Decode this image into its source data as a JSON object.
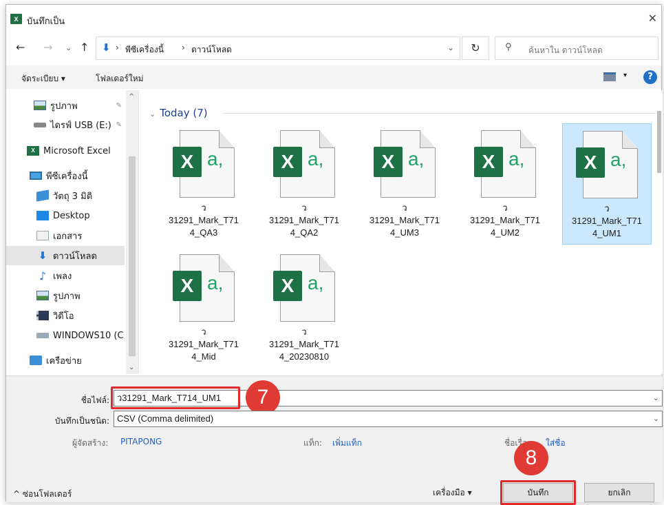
{
  "window": {
    "title": "บันทึกเป็น",
    "app_icon": "X"
  },
  "address": {
    "segment_1": "พีซีเครื่องนี้",
    "segment_2": "ดาวน์โหลด",
    "search_placeholder": "ค้นหาใน ดาวน์โหลด"
  },
  "toolbar": {
    "organize": "จัดระเบียบ ▾",
    "new_folder": "โฟลเดอร์ใหม่"
  },
  "sidebar": {
    "items": [
      {
        "label": "รูปภาพ",
        "icon": "pictures-icon",
        "pinned": true
      },
      {
        "label": "ไดรฟ์ USB (E:)",
        "icon": "usb-drive-icon",
        "pinned": true
      },
      {
        "label": "Microsoft Excel",
        "icon": "excel-icon"
      },
      {
        "label": "พีซีเครื่องนี้",
        "icon": "this-pc-icon"
      },
      {
        "label": "วัตถุ 3 มิติ",
        "icon": "3d-objects-icon"
      },
      {
        "label": "Desktop",
        "icon": "desktop-icon"
      },
      {
        "label": "เอกสาร",
        "icon": "documents-icon"
      },
      {
        "label": "ดาวน์โหลด",
        "icon": "downloads-icon",
        "selected": true
      },
      {
        "label": "เพลง",
        "icon": "music-icon"
      },
      {
        "label": "รูปภาพ",
        "icon": "pictures-icon"
      },
      {
        "label": "วิดีโอ",
        "icon": "videos-icon"
      },
      {
        "label": "WINDOWS10 (C",
        "icon": "drive-icon"
      },
      {
        "label": "เครือข่าย",
        "icon": "network-icon"
      }
    ]
  },
  "content": {
    "group_label": "Today (7)",
    "files": [
      {
        "name": "ว\n31291_Mark_T71\n4_QA3"
      },
      {
        "name": "ว\n31291_Mark_T71\n4_QA2"
      },
      {
        "name": "ว\n31291_Mark_T71\n4_UM3"
      },
      {
        "name": "ว\n31291_Mark_T71\n4_UM2"
      },
      {
        "name": "ว\n31291_Mark_T71\n4_UM1",
        "selected": true
      },
      {
        "name": "ว\n31291_Mark_T71\n4_Mid"
      },
      {
        "name": "ว\n31291_Mark_T71\n4_20230810"
      }
    ]
  },
  "form": {
    "filename_label": "ชื่อไฟล์:",
    "filename_value": "ว31291_Mark_T714_UM1",
    "type_label": "บันทึกเป็นชนิด:",
    "type_value": "CSV (Comma delimited)",
    "author_label": "ผู้จัดสร้าง:",
    "author_value": "PITAPONG",
    "tags_label": "แท็ก:",
    "tags_value": "เพิ่มแท็ก",
    "title_label": "ชื่อเรื่อง:",
    "title_value": "ใส่ชื่อ",
    "hide_folders": "^ ซ่อนโฟลเดอร์",
    "tools": "เครื่องมือ ▾",
    "save": "บันทึก",
    "cancel": "ยกเลิก"
  },
  "annotations": {
    "step_filename": "7",
    "step_save": "8",
    "highlight_color": "#e02a2a"
  }
}
